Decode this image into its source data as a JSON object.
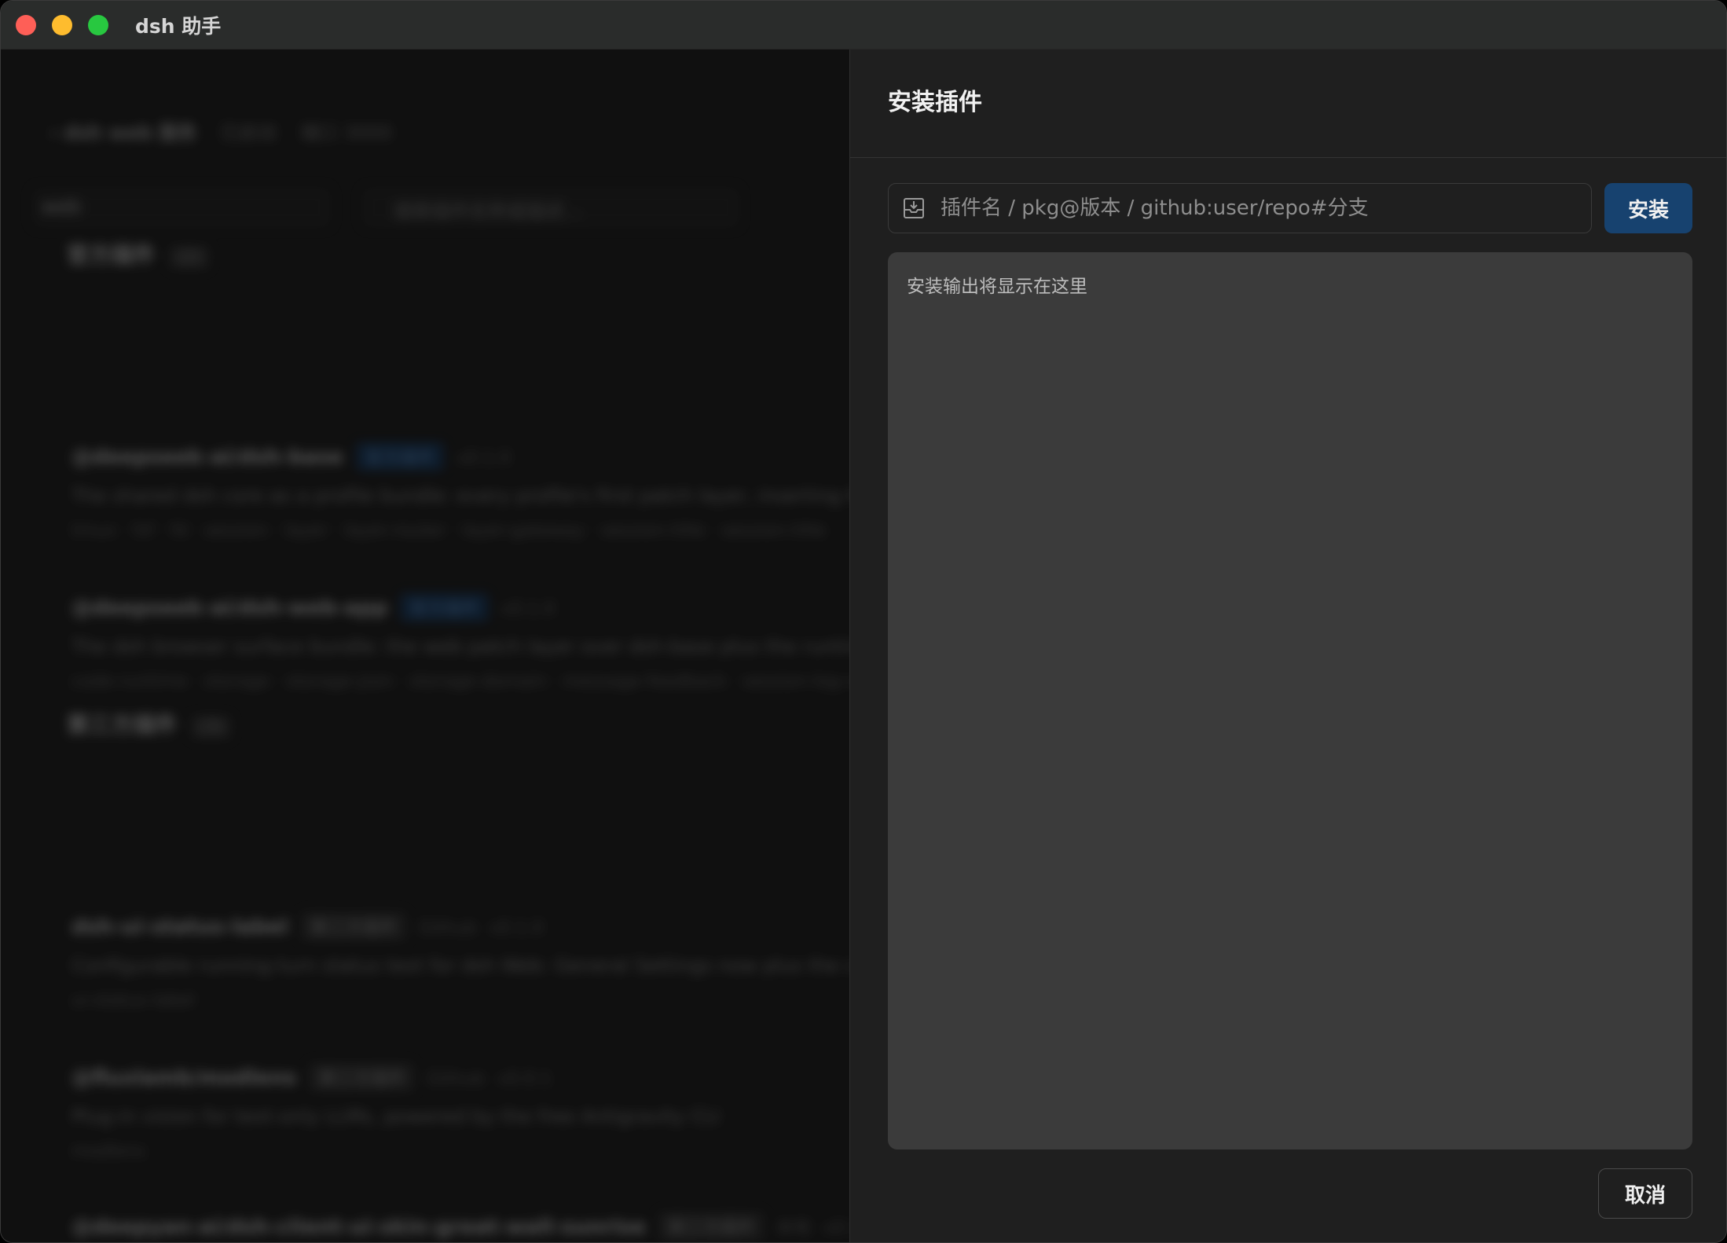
{
  "window": {
    "title": "dsh 助手"
  },
  "background": {
    "header": {
      "back": "‹ dsh web 服务",
      "status": "已启动",
      "port": "端口 3000"
    },
    "profile_select": "web",
    "search_placeholder": "搜索插件名称或描述...",
    "official_section": {
      "title": "官方插件",
      "count": "(2)"
    },
    "official_items": [
      {
        "name": "@deepseek-ai/dsh-base",
        "tag": "官方插件",
        "version": "v0.1.0",
        "desc": "The shared dsh core as a profile bundle: every profile's first patch layer, inserting the base",
        "keywords": "tmux · fzf · fd · session · layer · layer-router · layer-gateway · session-title · session-title"
      },
      {
        "name": "@deepseek-ai/dsh-web-app",
        "tag": "官方插件",
        "version": "v0.1.0",
        "desc": "The dsh browser surface bundle: the web patch layer over dsh-base plus the runtime pieces",
        "keywords": "code-runtime · storage · storage-json · storage-domain · message-feedback · session-log-view"
      }
    ],
    "third_section": {
      "title": "第三方插件",
      "count": "(3)"
    },
    "third_items": [
      {
        "name": "dsh-ui-status-label",
        "tag": "第三方插件",
        "source": "Github",
        "version": "v0.1.0",
        "desc": "Configurable running-turn status text for dsh Web: General Settings now plus the canonical",
        "keywords": "ui-status-label"
      },
      {
        "name": "@fluxlamb/modlens",
        "tag": "第三方插件",
        "source": "Github",
        "version": "v0.0.1",
        "desc": "Plug-in vision for text-only LLMs, powered by the free Antigravity CLI",
        "keywords": "modlens"
      },
      {
        "name": "@deepyan-ai/dsh-client-ui-skin-great-wall-sunrise",
        "tag": "第三方插件",
        "source": "本地",
        "version": "v0.1.0",
        "desc": "",
        "keywords": ""
      }
    ]
  },
  "drawer": {
    "title": "安装插件",
    "input": {
      "placeholder": "插件名 / pkg@版本 / github:user/repo#分支",
      "value": ""
    },
    "install_label": "安装",
    "output_placeholder": "安装输出将显示在这里",
    "cancel_label": "取消"
  }
}
